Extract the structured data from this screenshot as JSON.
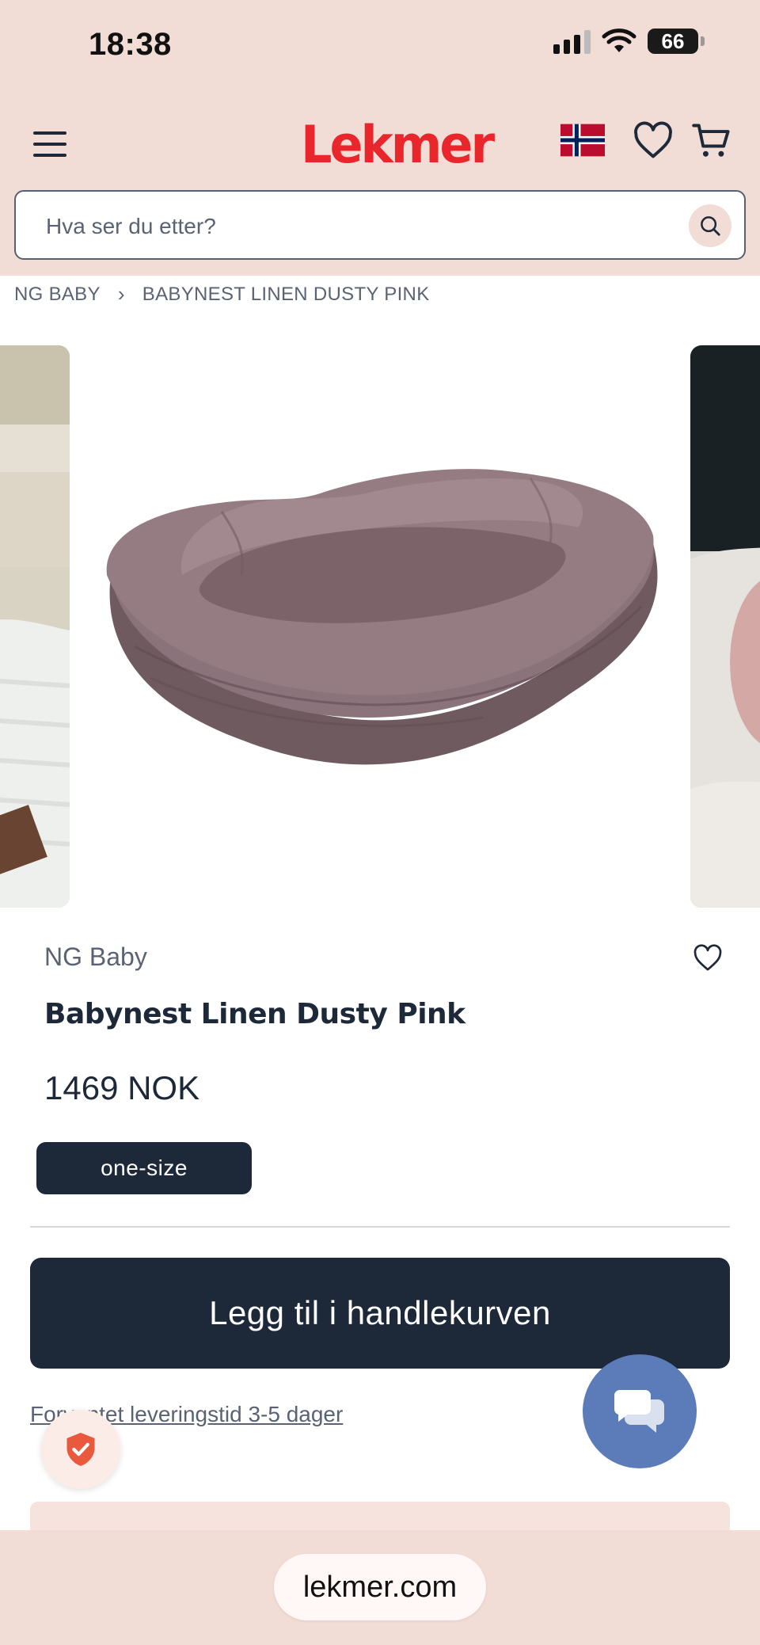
{
  "status_bar": {
    "time": "18:38",
    "battery": "66",
    "battery_level": 0.66
  },
  "header": {
    "logo": "Lekmer",
    "menu_icon": "hamburger-menu-icon",
    "flag_icon": "norway-flag-icon",
    "wishlist_icon": "heart-icon",
    "cart_icon": "shopping-cart-icon",
    "brand_color": "#e8262c",
    "background": "#f2dcd6"
  },
  "search": {
    "placeholder": "Hva ser du etter?",
    "icon": "search-icon"
  },
  "breadcrumb": {
    "items": [
      "NG BABY",
      "BABYNEST LINEN DUSTY PINK"
    ],
    "separator_icon": "chevron-right-icon"
  },
  "product": {
    "brand": "NG Baby",
    "title": "Babynest Linen Dusty Pink",
    "price": "1469 NOK",
    "size": "one-size",
    "add_to_cart_label": "Legg til i handlekurven",
    "delivery_text": "Forventet leveringstid 3-5 dager",
    "favorite_icon": "heart-outline-icon",
    "accent_color": "#1d2838"
  },
  "floating": {
    "chat_icon": "chat-bubbles-icon",
    "chat_color": "#5b7cb8",
    "trust_icon": "shield-check-icon"
  },
  "browser": {
    "url": "lekmer.com"
  }
}
